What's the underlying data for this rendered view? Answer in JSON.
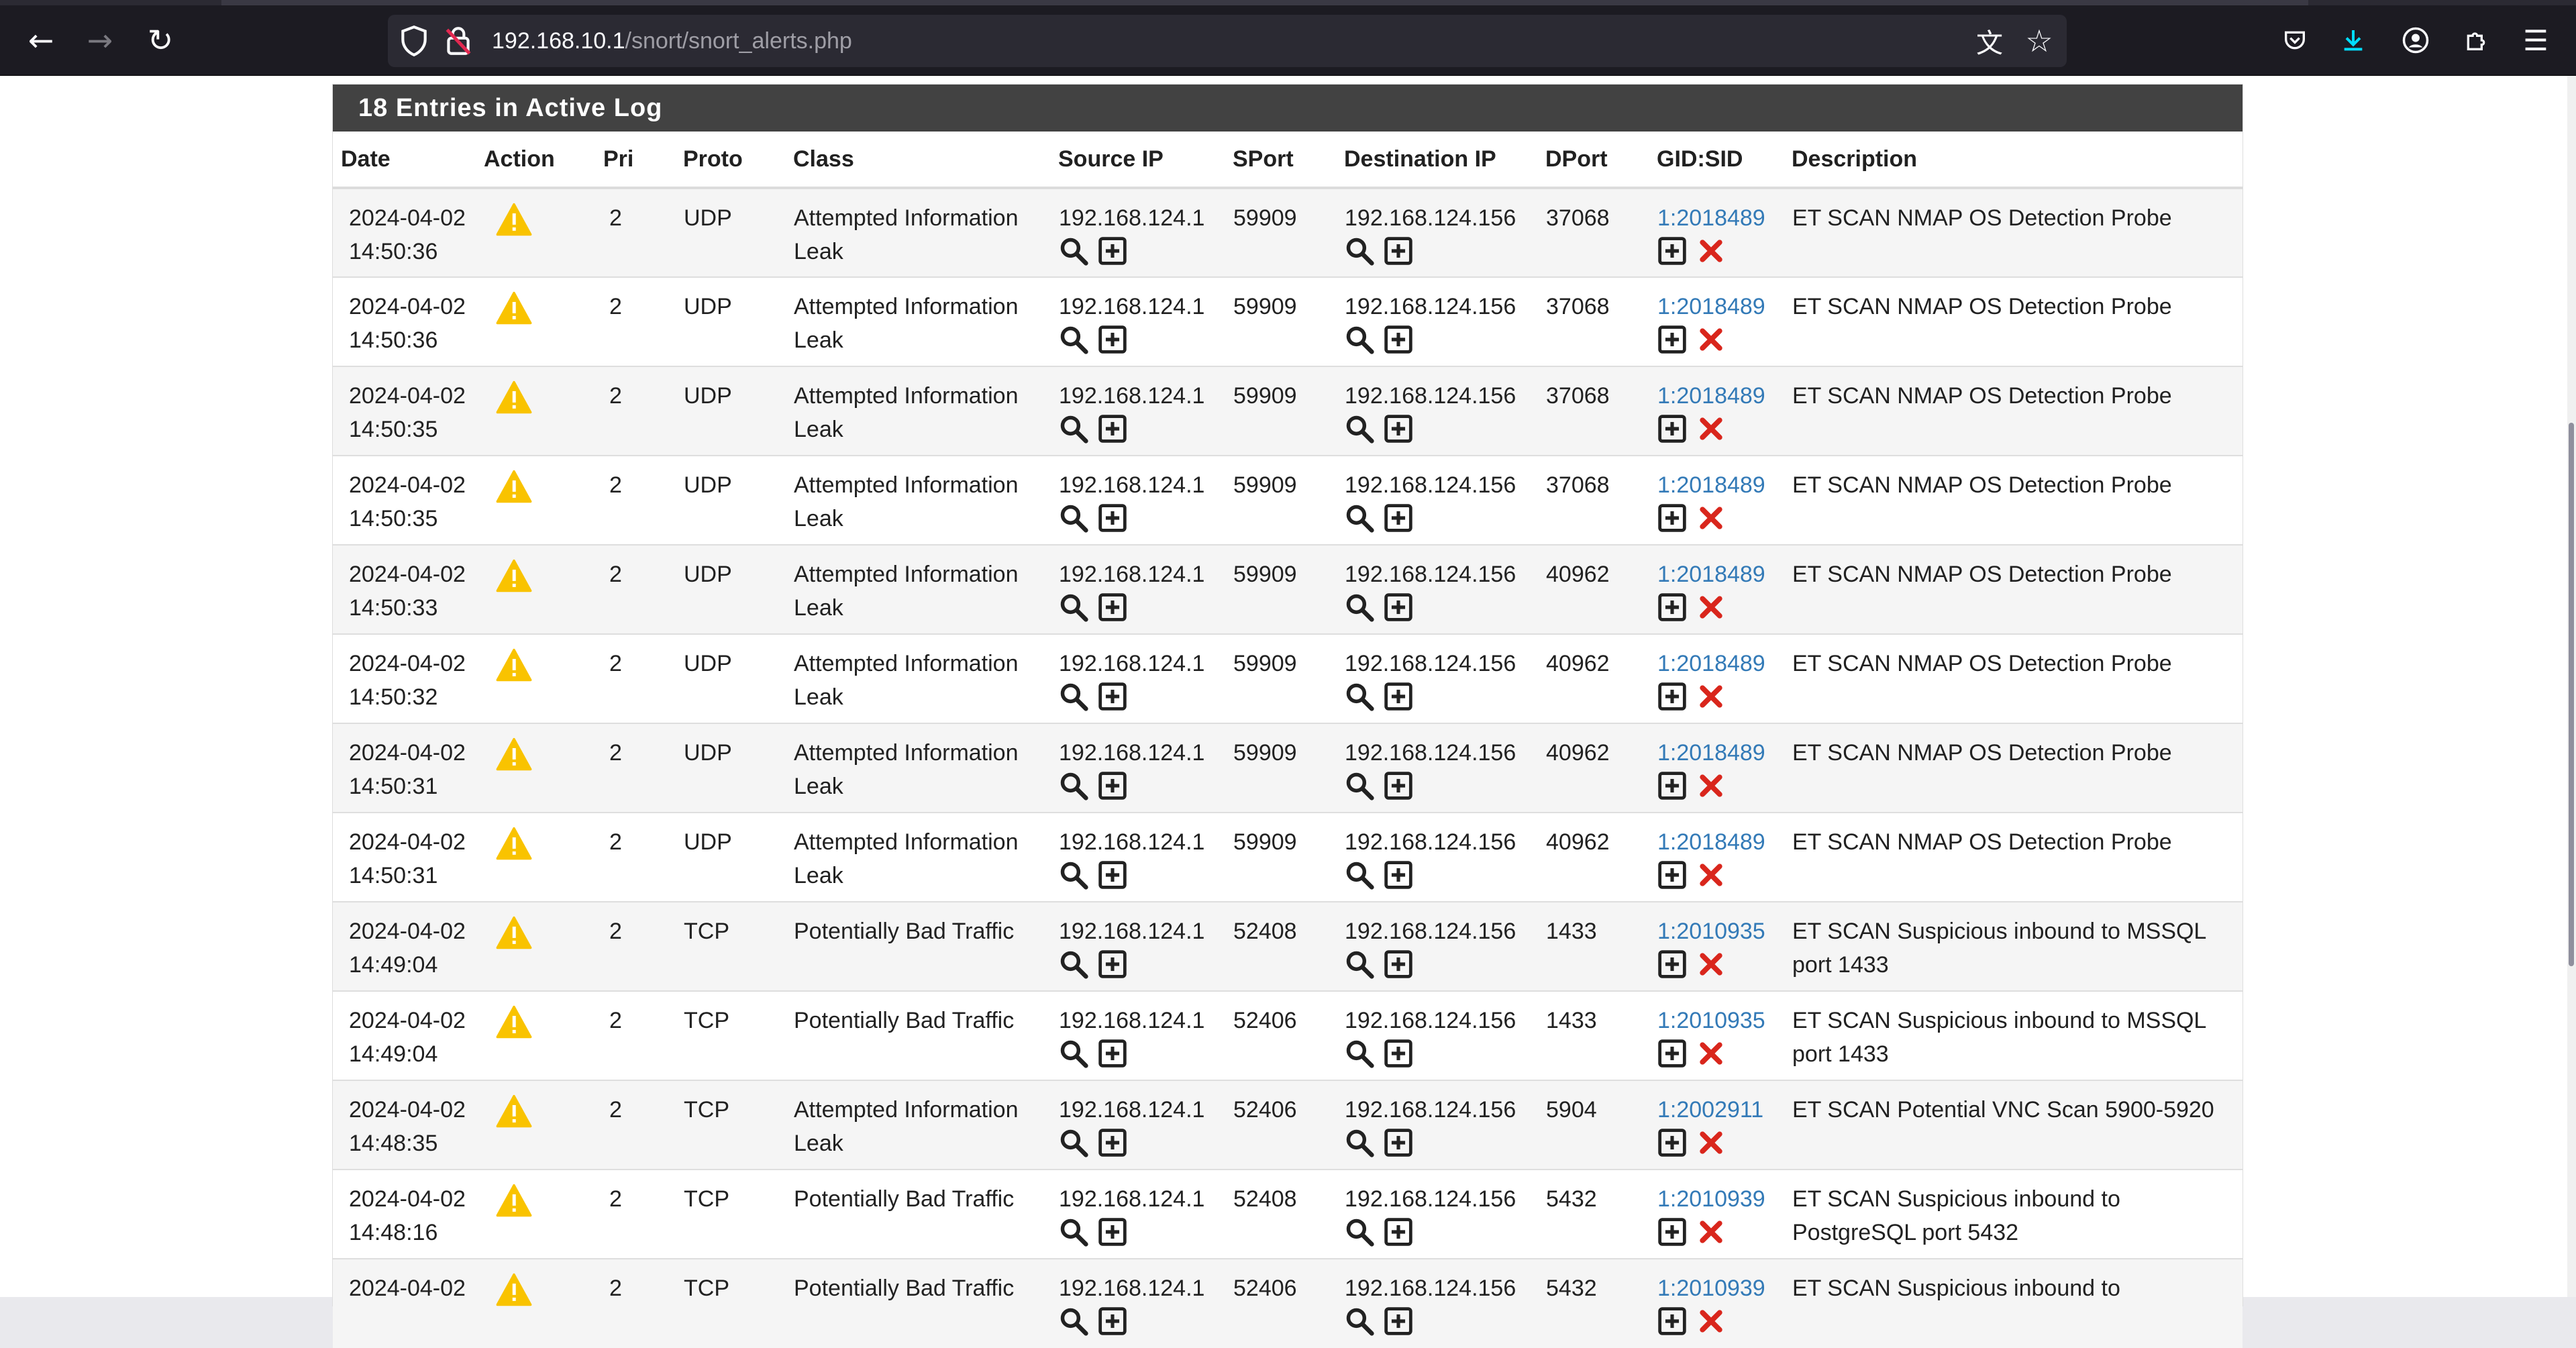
{
  "browser": {
    "url_host": "192.168.10.1",
    "url_path": "/snort/snort_alerts.php",
    "accent_download": "#00ddff"
  },
  "panel": {
    "title": "18 Entries in Active Log",
    "header_bg": "#424242"
  },
  "columns": {
    "date": "Date",
    "action": "Action",
    "pri": "Pri",
    "proto": "Proto",
    "class": "Class",
    "src": "Source IP",
    "sport": "SPort",
    "dst": "Destination IP",
    "dport": "DPort",
    "gidsid": "GID:SID",
    "desc": "Description"
  },
  "rows": [
    {
      "date": "2024-04-02",
      "time": "14:50:36",
      "pri": "2",
      "proto": "UDP",
      "class1": "Attempted Information",
      "class2": "Leak",
      "src": "192.168.124.1",
      "sport": "59909",
      "dst": "192.168.124.156",
      "dport": "37068",
      "sid": "1:2018489",
      "desc1": "ET SCAN NMAP OS Detection Probe",
      "desc2": ""
    },
    {
      "date": "2024-04-02",
      "time": "14:50:36",
      "pri": "2",
      "proto": "UDP",
      "class1": "Attempted Information",
      "class2": "Leak",
      "src": "192.168.124.1",
      "sport": "59909",
      "dst": "192.168.124.156",
      "dport": "37068",
      "sid": "1:2018489",
      "desc1": "ET SCAN NMAP OS Detection Probe",
      "desc2": ""
    },
    {
      "date": "2024-04-02",
      "time": "14:50:35",
      "pri": "2",
      "proto": "UDP",
      "class1": "Attempted Information",
      "class2": "Leak",
      "src": "192.168.124.1",
      "sport": "59909",
      "dst": "192.168.124.156",
      "dport": "37068",
      "sid": "1:2018489",
      "desc1": "ET SCAN NMAP OS Detection Probe",
      "desc2": ""
    },
    {
      "date": "2024-04-02",
      "time": "14:50:35",
      "pri": "2",
      "proto": "UDP",
      "class1": "Attempted Information",
      "class2": "Leak",
      "src": "192.168.124.1",
      "sport": "59909",
      "dst": "192.168.124.156",
      "dport": "37068",
      "sid": "1:2018489",
      "desc1": "ET SCAN NMAP OS Detection Probe",
      "desc2": ""
    },
    {
      "date": "2024-04-02",
      "time": "14:50:33",
      "pri": "2",
      "proto": "UDP",
      "class1": "Attempted Information",
      "class2": "Leak",
      "src": "192.168.124.1",
      "sport": "59909",
      "dst": "192.168.124.156",
      "dport": "40962",
      "sid": "1:2018489",
      "desc1": "ET SCAN NMAP OS Detection Probe",
      "desc2": ""
    },
    {
      "date": "2024-04-02",
      "time": "14:50:32",
      "pri": "2",
      "proto": "UDP",
      "class1": "Attempted Information",
      "class2": "Leak",
      "src": "192.168.124.1",
      "sport": "59909",
      "dst": "192.168.124.156",
      "dport": "40962",
      "sid": "1:2018489",
      "desc1": "ET SCAN NMAP OS Detection Probe",
      "desc2": ""
    },
    {
      "date": "2024-04-02",
      "time": "14:50:31",
      "pri": "2",
      "proto": "UDP",
      "class1": "Attempted Information",
      "class2": "Leak",
      "src": "192.168.124.1",
      "sport": "59909",
      "dst": "192.168.124.156",
      "dport": "40962",
      "sid": "1:2018489",
      "desc1": "ET SCAN NMAP OS Detection Probe",
      "desc2": ""
    },
    {
      "date": "2024-04-02",
      "time": "14:50:31",
      "pri": "2",
      "proto": "UDP",
      "class1": "Attempted Information",
      "class2": "Leak",
      "src": "192.168.124.1",
      "sport": "59909",
      "dst": "192.168.124.156",
      "dport": "40962",
      "sid": "1:2018489",
      "desc1": "ET SCAN NMAP OS Detection Probe",
      "desc2": ""
    },
    {
      "date": "2024-04-02",
      "time": "14:49:04",
      "pri": "2",
      "proto": "TCP",
      "class1": "Potentially Bad Traffic",
      "class2": "",
      "src": "192.168.124.1",
      "sport": "52408",
      "dst": "192.168.124.156",
      "dport": "1433",
      "sid": "1:2010935",
      "desc1": "ET SCAN Suspicious inbound to MSSQL",
      "desc2": "port 1433"
    },
    {
      "date": "2024-04-02",
      "time": "14:49:04",
      "pri": "2",
      "proto": "TCP",
      "class1": "Potentially Bad Traffic",
      "class2": "",
      "src": "192.168.124.1",
      "sport": "52406",
      "dst": "192.168.124.156",
      "dport": "1433",
      "sid": "1:2010935",
      "desc1": "ET SCAN Suspicious inbound to MSSQL",
      "desc2": "port 1433"
    },
    {
      "date": "2024-04-02",
      "time": "14:48:35",
      "pri": "2",
      "proto": "TCP",
      "class1": "Attempted Information",
      "class2": "Leak",
      "src": "192.168.124.1",
      "sport": "52406",
      "dst": "192.168.124.156",
      "dport": "5904",
      "sid": "1:2002911",
      "desc1": "ET SCAN Potential VNC Scan 5900-5920",
      "desc2": ""
    },
    {
      "date": "2024-04-02",
      "time": "14:48:16",
      "pri": "2",
      "proto": "TCP",
      "class1": "Potentially Bad Traffic",
      "class2": "",
      "src": "192.168.124.1",
      "sport": "52408",
      "dst": "192.168.124.156",
      "dport": "5432",
      "sid": "1:2010939",
      "desc1": "ET SCAN Suspicious inbound to",
      "desc2": "PostgreSQL port 5432"
    },
    {
      "date": "2024-04-02",
      "time": "",
      "pri": "2",
      "proto": "TCP",
      "class1": "Potentially Bad Traffic",
      "class2": "",
      "src": "192.168.124.1",
      "sport": "52406",
      "dst": "192.168.124.156",
      "dport": "5432",
      "sid": "1:2010939",
      "desc1": "ET SCAN Suspicious inbound to",
      "desc2": ""
    }
  ]
}
